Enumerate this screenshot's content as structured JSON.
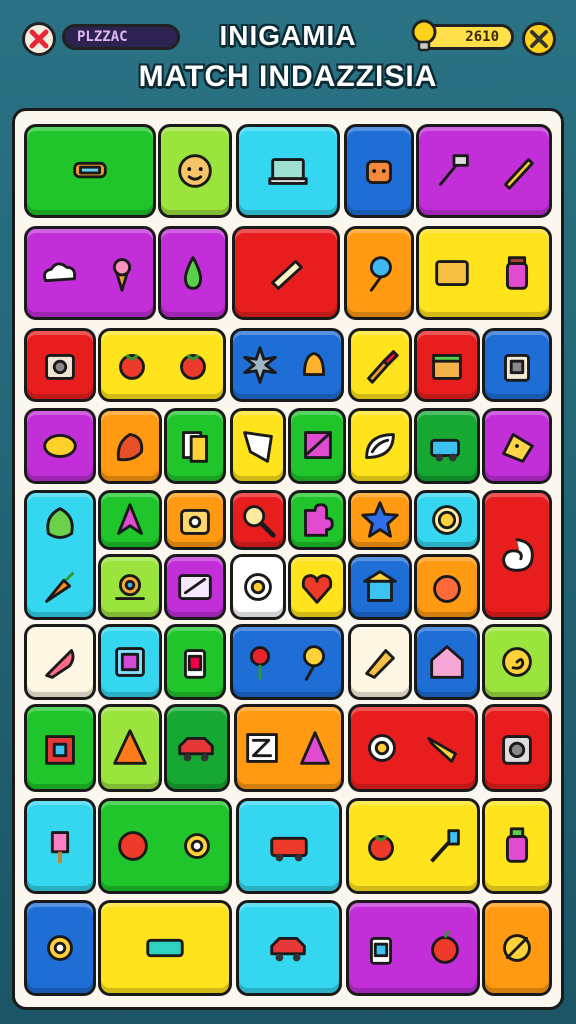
{
  "header": {
    "title_line1": "INIGAMIA",
    "title_line2": "MATCH INDAZZISIA",
    "player_label": "PLZZAC",
    "score_value": "2610"
  },
  "colors": {
    "green": "#1fc52a",
    "lime": "#9be33d",
    "cyan": "#35d6ef",
    "blue": "#1e6ed6",
    "purple": "#c22fd9",
    "yellow": "#ffe31c",
    "orange": "#ff9a12",
    "red": "#e81e1e",
    "cream": "#fdf6e3",
    "darkgreen": "#16a833",
    "white": "#ffffff"
  },
  "tiles": [
    {
      "name": "tile-grill",
      "color": "green",
      "icons": [
        "grill-icon"
      ]
    },
    {
      "name": "tile-face",
      "color": "lime",
      "icons": [
        "face-icon"
      ]
    },
    {
      "name": "tile-laptop",
      "color": "cyan",
      "icons": [
        "laptop-icon"
      ]
    },
    {
      "name": "tile-robot",
      "color": "blue",
      "icons": [
        "robot-head-icon"
      ]
    },
    {
      "name": "tile-tools",
      "color": "purple",
      "icons": [
        "hammer-icon",
        "pencil-icon"
      ]
    },
    {
      "name": "tile-cloud-cone",
      "color": "purple",
      "icons": [
        "cloud-icon",
        "ice-cream-icon"
      ]
    },
    {
      "name": "tile-pear",
      "color": "purple",
      "icons": [
        "pear-icon"
      ]
    },
    {
      "name": "tile-chalk",
      "color": "red",
      "icons": [
        "chalk-icon"
      ]
    },
    {
      "name": "tile-balloon",
      "color": "orange",
      "icons": [
        "balloon-icon"
      ]
    },
    {
      "name": "tile-tv-jar",
      "color": "yellow",
      "icons": [
        "tv-icon",
        "jar-icon"
      ]
    },
    {
      "name": "tile-camera",
      "color": "red",
      "icons": [
        "camera-icon"
      ]
    },
    {
      "name": "tile-tomatoes",
      "color": "yellow",
      "icons": [
        "tomato-icon",
        "tomato-icon"
      ]
    },
    {
      "name": "tile-spike-bell",
      "color": "blue",
      "icons": [
        "spike-icon",
        "bell-icon"
      ]
    },
    {
      "name": "tile-brush",
      "color": "yellow",
      "icons": [
        "brush-icon"
      ]
    },
    {
      "name": "tile-cake",
      "color": "red",
      "icons": [
        "cake-icon"
      ]
    },
    {
      "name": "tile-bag",
      "color": "blue",
      "icons": [
        "bag-icon"
      ]
    },
    {
      "name": "tile-lemon",
      "color": "purple",
      "icons": [
        "lemon-icon"
      ]
    },
    {
      "name": "tile-dragon",
      "color": "orange",
      "icons": [
        "dragon-icon"
      ]
    },
    {
      "name": "tile-cards",
      "color": "green",
      "icons": [
        "cards-icon"
      ]
    },
    {
      "name": "tile-paper",
      "color": "yellow",
      "icons": [
        "paper-icon"
      ]
    },
    {
      "name": "tile-flag",
      "color": "green",
      "icons": [
        "flag-icon"
      ]
    },
    {
      "name": "tile-leaf",
      "color": "yellow",
      "icons": [
        "leaf-icon"
      ]
    },
    {
      "name": "tile-truck",
      "color": "darkgreen",
      "icons": [
        "truck-icon"
      ]
    },
    {
      "name": "tile-cheese",
      "color": "purple",
      "icons": [
        "cheese-icon"
      ]
    },
    {
      "name": "tile-lettuce-carrot",
      "color": "cyan",
      "icons": [
        "lettuce-icon",
        "carrot-icon"
      ]
    },
    {
      "name": "tile-arrow",
      "color": "green",
      "icons": [
        "arrow-icon"
      ]
    },
    {
      "name": "tile-cooker",
      "color": "orange",
      "icons": [
        "cooker-icon"
      ]
    },
    {
      "name": "tile-magnifier",
      "color": "red",
      "icons": [
        "magnifier-icon"
      ]
    },
    {
      "name": "tile-puzzle",
      "color": "green",
      "icons": [
        "puzzle-icon"
      ]
    },
    {
      "name": "tile-star",
      "color": "orange",
      "icons": [
        "star-icon"
      ]
    },
    {
      "name": "tile-coin",
      "color": "cyan",
      "icons": [
        "coin-icon"
      ]
    },
    {
      "name": "tile-swirl",
      "color": "red",
      "icons": [
        "swirl-icon"
      ]
    },
    {
      "name": "tile-snail",
      "color": "lime",
      "icons": [
        "snail-icon"
      ]
    },
    {
      "name": "tile-ticket",
      "color": "purple",
      "icons": [
        "ticket-icon"
      ]
    },
    {
      "name": "tile-egg",
      "color": "white",
      "icons": [
        "egg-icon"
      ]
    },
    {
      "name": "tile-heart",
      "color": "yellow",
      "icons": [
        "heart-icon"
      ]
    },
    {
      "name": "tile-temple",
      "color": "blue",
      "icons": [
        "temple-icon"
      ]
    },
    {
      "name": "tile-peach",
      "color": "orange",
      "icons": [
        "peach-icon"
      ]
    },
    {
      "name": "tile-rocket",
      "color": "cream",
      "icons": [
        "rocket-icon"
      ]
    },
    {
      "name": "tile-picture",
      "color": "cyan",
      "icons": [
        "picture-icon"
      ]
    },
    {
      "name": "tile-lantern",
      "color": "green",
      "icons": [
        "lantern-icon"
      ]
    },
    {
      "name": "tile-flower-lolly",
      "color": "blue",
      "icons": [
        "flower-icon",
        "lollipop-icon"
      ]
    },
    {
      "name": "tile-sandwich",
      "color": "cream",
      "icons": [
        "sandwich-icon"
      ]
    },
    {
      "name": "tile-house",
      "color": "blue",
      "icons": [
        "house-icon"
      ]
    },
    {
      "name": "tile-spiral",
      "color": "lime",
      "icons": [
        "spiral-icon"
      ]
    },
    {
      "name": "tile-box",
      "color": "green",
      "icons": [
        "box-icon"
      ]
    },
    {
      "name": "tile-cone",
      "color": "lime",
      "icons": [
        "cone-icon"
      ]
    },
    {
      "name": "tile-car-red",
      "color": "darkgreen",
      "icons": [
        "car-icon"
      ]
    },
    {
      "name": "tile-letters",
      "color": "orange",
      "icons": [
        "letter-z-icon",
        "letter-a-icon"
      ]
    },
    {
      "name": "tile-egg-horn",
      "color": "red",
      "icons": [
        "egg-icon",
        "horn-icon"
      ]
    },
    {
      "name": "tile-radio",
      "color": "red",
      "icons": [
        "radio-icon"
      ]
    },
    {
      "name": "tile-popsicle",
      "color": "cyan",
      "icons": [
        "popsicle-icon"
      ]
    },
    {
      "name": "tile-ball-gear",
      "color": "green",
      "icons": [
        "ball-icon",
        "gear-icon"
      ]
    },
    {
      "name": "tile-firetruck",
      "color": "cyan",
      "icons": [
        "firetruck-icon"
      ]
    },
    {
      "name": "tile-tomato-screw",
      "color": "yellow",
      "icons": [
        "tomato-icon",
        "screwdriver-icon"
      ]
    },
    {
      "name": "tile-glue",
      "color": "yellow",
      "icons": [
        "glue-icon"
      ]
    },
    {
      "name": "tile-gear",
      "color": "blue",
      "icons": [
        "gear-icon"
      ]
    },
    {
      "name": "tile-ruler",
      "color": "yellow",
      "icons": [
        "ruler-icon"
      ]
    },
    {
      "name": "tile-car",
      "color": "cyan",
      "icons": [
        "car-icon"
      ]
    },
    {
      "name": "tile-lamp-apple",
      "color": "purple",
      "icons": [
        "lamp-icon",
        "apple-icon"
      ]
    },
    {
      "name": "tile-knot",
      "color": "orange",
      "icons": [
        "knot-icon"
      ]
    }
  ]
}
